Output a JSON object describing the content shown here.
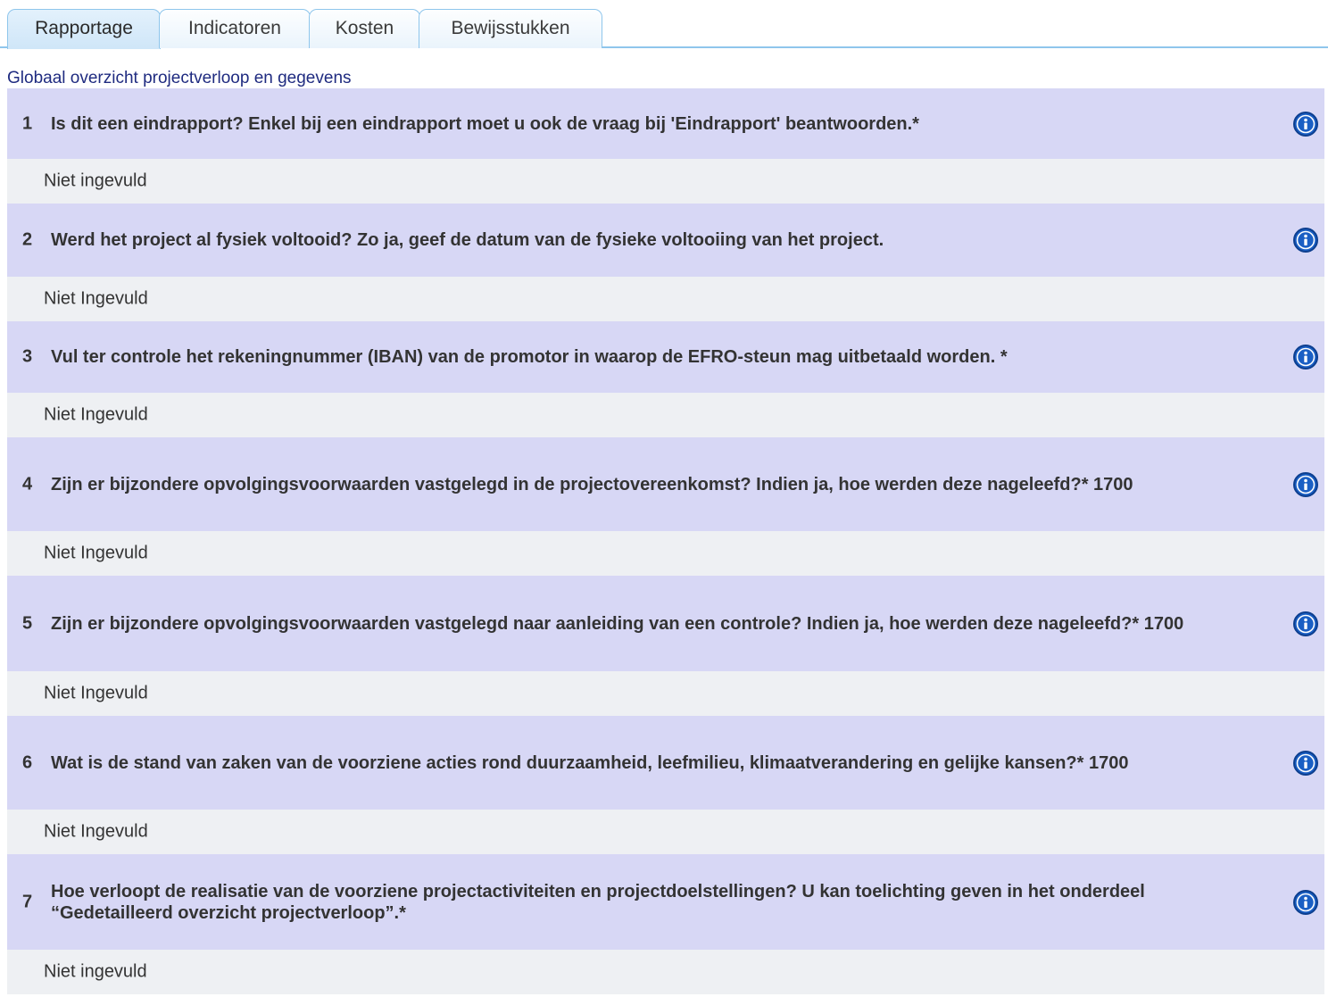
{
  "tabs": [
    {
      "label": "Rapportage",
      "active": true
    },
    {
      "label": "Indicatoren",
      "active": false
    },
    {
      "label": "Kosten",
      "active": false
    },
    {
      "label": "Bewijsstukken",
      "active": false
    }
  ],
  "section_title": "Globaal overzicht projectverloop en gegevens",
  "questions": [
    {
      "number": "1",
      "text": "Is dit een eindrapport? Enkel bij een eindrapport moet u ook de vraag bij 'Eindrapport' beantwoorden.*",
      "answer": "Niet ingevuld",
      "icon": "info-icon"
    },
    {
      "number": "2",
      "text": "Werd het project al fysiek voltooid? Zo ja, geef de datum van de fysieke voltooiing van het project.",
      "answer": "Niet Ingevuld",
      "icon": "info-icon"
    },
    {
      "number": "3",
      "text": "Vul ter controle het rekeningnummer (IBAN) van de promotor in waarop de EFRO-steun mag uitbetaald worden. *",
      "answer": "Niet Ingevuld",
      "icon": "info-icon"
    },
    {
      "number": "4",
      "text": "Zijn er bijzondere opvolgingsvoorwaarden vastgelegd in de projectovereenkomst? Indien ja, hoe werden deze nageleefd?* 1700",
      "answer": "Niet Ingevuld",
      "icon": "info-icon"
    },
    {
      "number": "5",
      "text": "Zijn er bijzondere opvolgingsvoorwaarden vastgelegd naar aanleiding van een controle? Indien ja, hoe werden deze nageleefd?* 1700",
      "answer": "Niet Ingevuld",
      "icon": "info-icon"
    },
    {
      "number": "6",
      "text": "Wat is de stand van zaken van de voorziene acties rond duurzaamheid, leefmilieu, klimaatverandering en gelijke kansen?* 1700",
      "answer": "Niet Ingevuld",
      "icon": "info-icon"
    },
    {
      "number": "7",
      "text": "Hoe verloopt de realisatie van de voorziene projectactiviteiten en projectdoelstellingen? U kan toelichting geven in het onderdeel “Gedetailleerd overzicht projectverloop”.*",
      "answer": "Niet ingevuld",
      "icon": "info-icon"
    }
  ],
  "colors": {
    "tab_border": "#8fc6ec",
    "question_bg": "#d7d7f5",
    "answer_bg": "#eef0f3",
    "title_text": "#1f2b80",
    "info_icon": "#1a5fc4"
  }
}
